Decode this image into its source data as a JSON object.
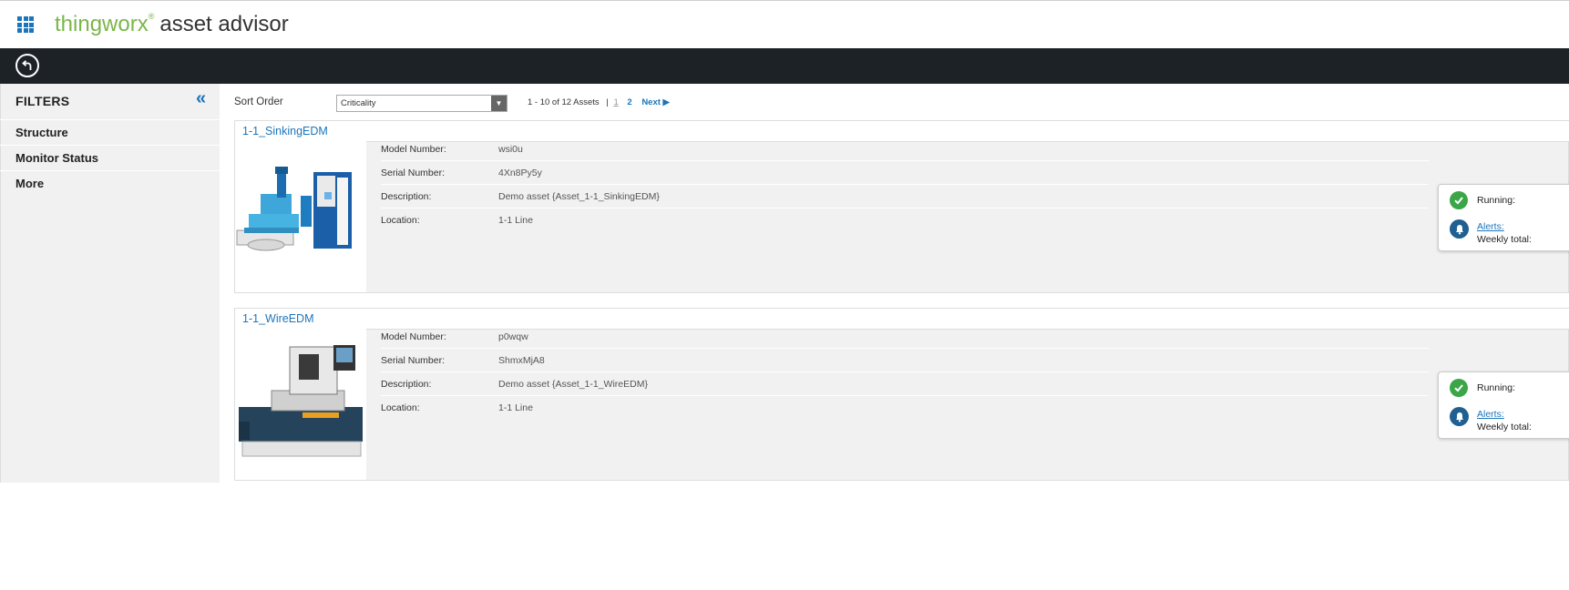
{
  "header": {
    "brand_main": "thingworx",
    "brand_reg": "®",
    "brand_product": "asset advisor"
  },
  "sidebar": {
    "title": "FILTERS",
    "collapse_glyph": "«",
    "items": [
      {
        "label": "Structure"
      },
      {
        "label": "Monitor Status"
      },
      {
        "label": "More"
      }
    ]
  },
  "toolbar": {
    "sort_label": "Sort Order",
    "sort_value": "Criticality",
    "range_text": "1 - 10 of 12 Assets",
    "separator": "|",
    "page_current": "1",
    "page_next_num": "2",
    "next_label": "Next ▶"
  },
  "assets": [
    {
      "name": "1-1_SinkingEDM",
      "props": [
        {
          "key": "Model Number:",
          "value": "wsi0u"
        },
        {
          "key": "Serial Number:",
          "value": "4Xn8Py5y"
        },
        {
          "key": "Description:",
          "value": "Demo asset {Asset_1-1_SinkingEDM}"
        },
        {
          "key": "Location:",
          "value": "1-1 Line"
        }
      ],
      "status": {
        "running_label": "Running:",
        "alerts_label": "Alerts:",
        "weekly_label": "Weekly total:"
      }
    },
    {
      "name": "1-1_WireEDM",
      "props": [
        {
          "key": "Model Number:",
          "value": "p0wqw"
        },
        {
          "key": "Serial Number:",
          "value": "ShmxMjA8"
        },
        {
          "key": "Description:",
          "value": "Demo asset {Asset_1-1_WireEDM}"
        },
        {
          "key": "Location:",
          "value": "1-1 Line"
        }
      ],
      "status": {
        "running_label": "Running:",
        "alerts_label": "Alerts:",
        "weekly_label": "Weekly total:"
      }
    }
  ],
  "colors": {
    "brand_green": "#7ab648",
    "link_blue": "#1b75bb",
    "dark_bar": "#1c2226",
    "ok_green": "#3aa648"
  }
}
